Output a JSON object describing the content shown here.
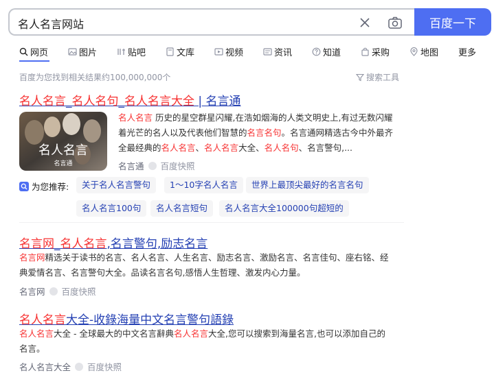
{
  "search": {
    "query": "名人名言网站",
    "button_label": "百度一下"
  },
  "tabs": [
    {
      "label": "网页",
      "icon": "search-icon"
    },
    {
      "label": "图片",
      "icon": "image-icon"
    },
    {
      "label": "贴吧",
      "icon": "tieba-icon"
    },
    {
      "label": "文库",
      "icon": "doc-icon"
    },
    {
      "label": "视频",
      "icon": "video-icon"
    },
    {
      "label": "资讯",
      "icon": "news-icon"
    },
    {
      "label": "知道",
      "icon": "question-icon"
    },
    {
      "label": "采购",
      "icon": "bag-icon"
    },
    {
      "label": "地图",
      "icon": "map-icon"
    },
    {
      "label": "更多",
      "icon": ""
    }
  ],
  "stats": {
    "result_count": "百度为您找到相关结果约100,000,000个",
    "search_tools": "搜索工具"
  },
  "results": [
    {
      "title_parts": [
        "名人名言",
        "_",
        "名人名句",
        "_",
        "名人名言大全",
        " | 名言通"
      ],
      "thumb_text": "名人名言",
      "thumb_sub": "名言通",
      "snippet_lines": [
        [
          [
            "名人名言",
            "hl"
          ],
          [
            " 历史的星空群星闪耀,在浩如烟海的人类文明史上,有过无数闪耀",
            ""
          ]
        ],
        [
          [
            "着光芒的名人以及代表他们智慧的",
            ""
          ],
          [
            "名言名句",
            "hl"
          ],
          [
            "。名言通网精选古今中外最齐",
            ""
          ]
        ],
        [
          [
            "全最经典的",
            ""
          ],
          [
            "名人名言",
            "hl"
          ],
          [
            "、",
            ""
          ],
          [
            "名人名言",
            "hl"
          ],
          [
            "大全、",
            ""
          ],
          [
            "名人名句",
            "hl"
          ],
          [
            "、名言警句,...",
            ""
          ]
        ]
      ],
      "source": "名言通",
      "cache": "百度快照"
    },
    {
      "title_parts": [
        "名言网",
        "_",
        "名人名言",
        ",名言警句,励志名言",
        "",
        ""
      ],
      "snippet_lines": [
        [
          [
            "名言网",
            "hl"
          ],
          [
            "精选关于读书的名言、名人名言、人生名言、励志名言、激励名言、名言佳句、座右铭、经",
            ""
          ]
        ],
        [
          [
            "典爱情名言、名言警句大全。品读名言名句,感悟人生哲理、激发内心力量。",
            ""
          ]
        ]
      ],
      "source": "名言网",
      "cache": "百度快照"
    },
    {
      "title_parts": [
        "名人名言",
        "大全-收錄海量中文名言警句語錄",
        "",
        "",
        "",
        ""
      ],
      "snippet_lines": [
        [
          [
            "名人名言",
            "hl"
          ],
          [
            "大全 - 全球最大的中文名言辭典",
            ""
          ],
          [
            "名人名言",
            "hl"
          ],
          [
            "大全,您可以搜索到海量名言,也可以添加自己的",
            ""
          ]
        ],
        [
          [
            "名言。",
            ""
          ]
        ]
      ],
      "source": "名人名言大全",
      "cache": "百度快照"
    }
  ],
  "recommend": {
    "label": "为您推荐:",
    "chips": [
      "关于名人名言警句",
      "1～10字名人名言",
      "世界上最顶尖最好的名言名句",
      "名人名言100句",
      "名人名言短句",
      "名人名言大全100000句超短的"
    ]
  },
  "colors": {
    "accent": "#4e6ef2",
    "link": "#2440b3",
    "highlight": "#f73131",
    "muted": "#9195a3"
  }
}
